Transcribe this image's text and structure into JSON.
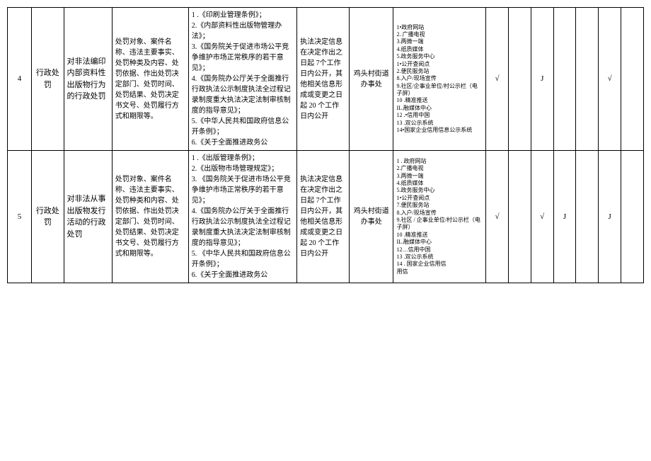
{
  "rows": [
    {
      "no": "4",
      "type": "行政处罚",
      "name": "对非法编印内部资料性出版物行为的行政处罚",
      "content": "处罚对象、案件名称、违法主要事实、处罚种类及内容、处罚依据、作出处罚决定部门、处罚时间、处罚结果、处罚决定书文号、处罚履行方式和期限等。",
      "basis": "1 .《印刷业管理条例》；\n2.《内部资料性出版物管理办法》；\n3.《国务院关于促进市场公平竞争维护市场正常秩序的若干意见》；\n4.《国务院办公厅关于全面推行行政执法公示制度执法全过程记录制度重大执法决定法制审核制度的指导意见》；\n5.《中华人民共和国政府信息公开条例》；\n6.《关于全面推进政务公",
      "time": "执法决定信息在决定作出之日起 7个工作日内公开，其他相关信息形成或变更之日起 20 个工作日内公开",
      "subject": "鸡头村街道办事处",
      "channels": [
        "1•政府网站",
        "2. 广播电视",
        "3.两微一端",
        "4.纸质媒体",
        "5.政务服务中心",
        "1•公开查阅点",
        "2.便民服务站",
        "8.入户/现场宣传",
        "9.社区/企事业单位/村公示栏（电子屏）",
        "10        .精准推送",
        "IL.融媒体中心",
        "12        .•信用中国",
        "13        .双公示系统",
        "14•国家企业信用信息公示系统"
      ],
      "checks": [
        "√",
        "",
        "J",
        "",
        "",
        "√",
        ""
      ]
    },
    {
      "no": "5",
      "type": "行政处罚",
      "name": "对非法从事出版物发行活动的行政处罚",
      "content": "处罚对象、案件名称、违法主要事实、处罚种类和内容、处罚依据、作出处罚决定部门、处罚时间、处罚结果、处罚决定书文号、处罚履行方式和期限等。",
      "basis": "1 .《出版管理条例》；\n2.《出版物市场管理规定》；\n3. 《国务院关于促进市场公平竞争维护市场正常秩序的若干意见》；\n4.《国务院办公厅关于全面推行行政执法公示制度执法全过程记录制度重大执法决定法制审核制度的指导意见》；\n5. 《中华人民共和国政府信息公开条例》；\n6.《关于全面推进政务公",
      "time": "执法决定信息在决定作出之日起 7个工作日内公开，其他相关信息形成或变更之日起 20 个工作日内公开",
      "subject": "鸡头村街道办事处",
      "channels": [
        "1      . 政府网站",
        "2.广播电视",
        "3.两微一端",
        "4.纸质媒体",
        "5.政务服务中心",
        "1•公开查阅点",
        "7.便民服务站",
        "8.入户/现场宣传",
        "9.社区 / 企事业单位/村公示栏（电子屏）",
        "10        .精准推送",
        "IL.融媒体中心",
        "12…信用中国",
        "13        .双公示系统",
        "14        . 国家企业信用信",
        "用信"
      ],
      "checks": [
        "√",
        "",
        "√",
        "J",
        "",
        "J",
        ""
      ]
    }
  ]
}
